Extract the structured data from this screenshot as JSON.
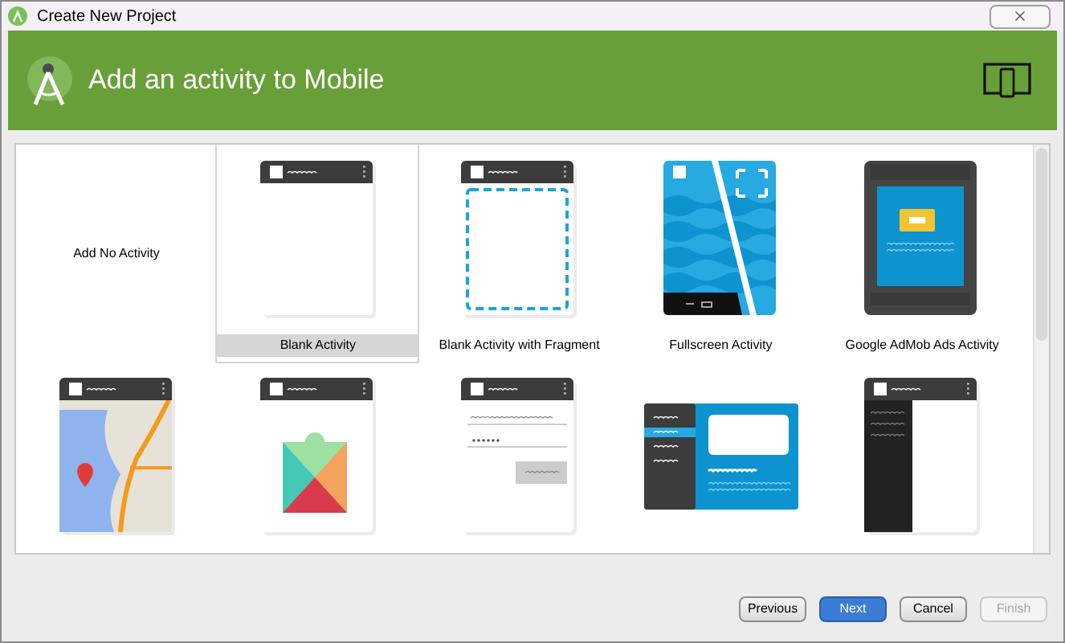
{
  "window": {
    "title": "Create New Project"
  },
  "header": {
    "title": "Add an activity to Mobile"
  },
  "activities": [
    {
      "kind": "none",
      "label": "Add No Activity",
      "selected": false
    },
    {
      "kind": "blank",
      "label": "Blank Activity",
      "selected": true
    },
    {
      "kind": "fragment",
      "label": "Blank Activity with Fragment",
      "selected": false
    },
    {
      "kind": "fullscreen",
      "label": "Fullscreen Activity",
      "selected": false
    },
    {
      "kind": "admob",
      "label": "Google AdMob Ads Activity",
      "selected": false
    },
    {
      "kind": "map",
      "selected": false
    },
    {
      "kind": "play",
      "selected": false
    },
    {
      "kind": "login",
      "selected": false
    },
    {
      "kind": "masterdetail",
      "selected": false
    },
    {
      "kind": "drawer",
      "selected": false
    }
  ],
  "buttons": [
    {
      "kind": "previous",
      "label": "Previous",
      "disabled": false
    },
    {
      "kind": "next",
      "label": "Next",
      "disabled": false
    },
    {
      "kind": "cancel",
      "label": "Cancel",
      "disabled": false
    },
    {
      "kind": "finish",
      "label": "Finish",
      "disabled": true
    }
  ]
}
